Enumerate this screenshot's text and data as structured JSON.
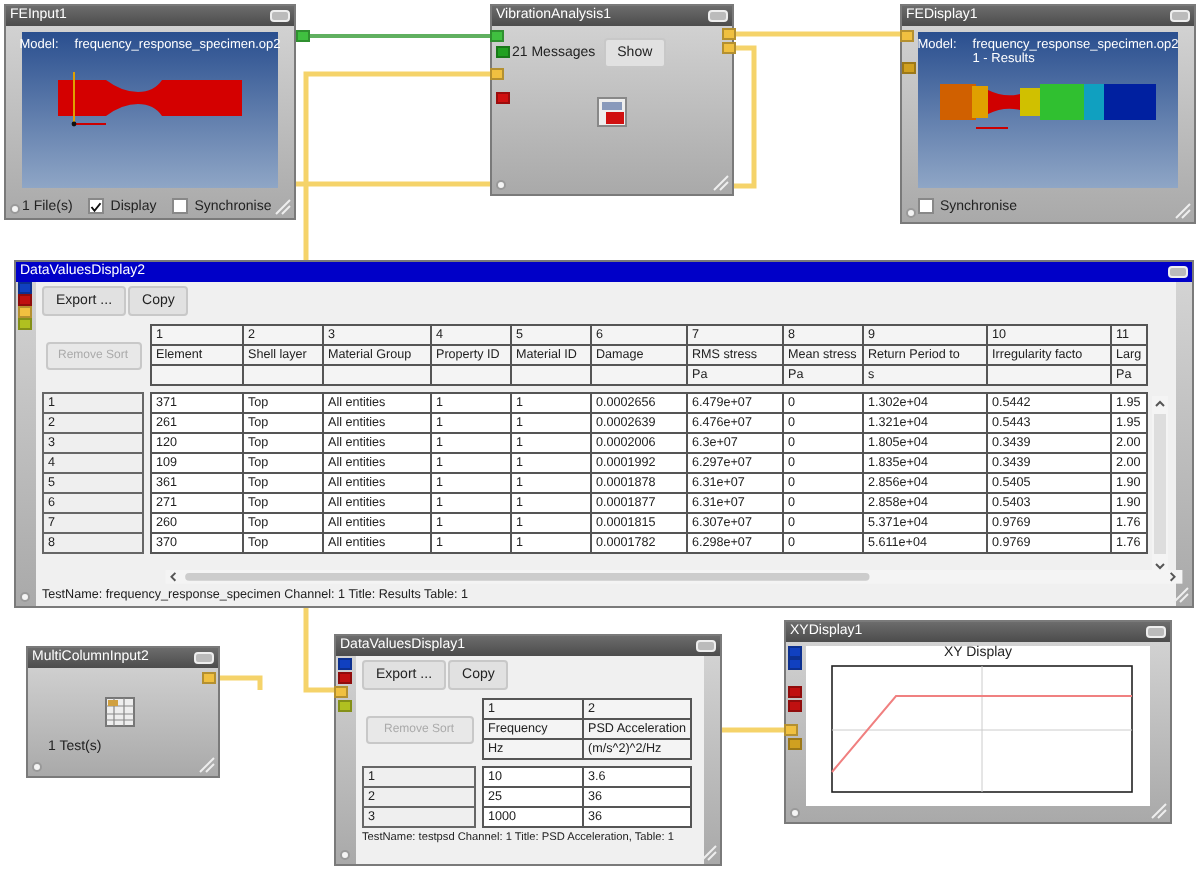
{
  "nodes": [
    {
      "kind": "fe_input",
      "title": "FEInput1",
      "selected": false,
      "model_label": "Model:",
      "model_file": "frequency_response_specimen.op2",
      "file_count": "1 File(s)",
      "display": {
        "label": "Display",
        "checked": true
      },
      "synchronise": {
        "label": "Synchronise",
        "checked": false
      }
    },
    {
      "kind": "vibration",
      "title": "VibrationAnalysis1",
      "selected": false,
      "messages": "21 Messages",
      "show_button": "Show"
    },
    {
      "kind": "fe_display",
      "title": "FEDisplay1",
      "selected": false,
      "model_label": "Model:",
      "model_file": "frequency_response_specimen.op2",
      "result": "1 - Results",
      "synchronise": {
        "label": "Synchronise",
        "checked": false
      }
    },
    {
      "kind": "table",
      "title": "DataValuesDisplay2",
      "selected": true,
      "buttons": [
        "Export ...",
        "Copy"
      ],
      "remove_sort": {
        "label": "Remove Sort",
        "disabled": true
      },
      "columns": [
        {
          "number": "1",
          "name": "Element"
        },
        {
          "number": "2",
          "name": "Shell layer"
        },
        {
          "number": "3",
          "name": "Material Group"
        },
        {
          "number": "4",
          "name": "Property ID"
        },
        {
          "number": "5",
          "name": "Material ID"
        },
        {
          "number": "6",
          "name": "Damage"
        },
        {
          "number": "7",
          "name": "RMS stress",
          "unit": "Pa"
        },
        {
          "number": "8",
          "name": "Mean stress",
          "unit": "Pa"
        },
        {
          "number": "9",
          "name": "Return Period to",
          "unit": "s"
        },
        {
          "number": "10",
          "name": "Irregularity facto"
        },
        {
          "number": "11",
          "name": "Larg",
          "unit": "Pa"
        }
      ],
      "rows": [
        {
          "header": "1",
          "cells": [
            "371",
            "Top",
            "All entities",
            "1",
            "1",
            "0.0002656",
            "6.479e+07",
            "0",
            "1.302e+04",
            "0.5442",
            "1.95"
          ]
        },
        {
          "header": "2",
          "cells": [
            "261",
            "Top",
            "All entities",
            "1",
            "1",
            "0.0002639",
            "6.476e+07",
            "0",
            "1.321e+04",
            "0.5443",
            "1.95"
          ]
        },
        {
          "header": "3",
          "cells": [
            "120",
            "Top",
            "All entities",
            "1",
            "1",
            "0.0002006",
            "6.3e+07",
            "0",
            "1.805e+04",
            "0.3439",
            "2.00"
          ]
        },
        {
          "header": "4",
          "cells": [
            "109",
            "Top",
            "All entities",
            "1",
            "1",
            "0.0001992",
            "6.297e+07",
            "0",
            "1.835e+04",
            "0.3439",
            "2.00"
          ]
        },
        {
          "header": "5",
          "cells": [
            "361",
            "Top",
            "All entities",
            "1",
            "1",
            "0.0001878",
            "6.31e+07",
            "0",
            "2.856e+04",
            "0.5405",
            "1.90"
          ]
        },
        {
          "header": "6",
          "cells": [
            "271",
            "Top",
            "All entities",
            "1",
            "1",
            "0.0001877",
            "6.31e+07",
            "0",
            "2.858e+04",
            "0.5403",
            "1.90"
          ]
        },
        {
          "header": "7",
          "cells": [
            "260",
            "Top",
            "All entities",
            "1",
            "1",
            "0.0001815",
            "6.307e+07",
            "0",
            "5.371e+04",
            "0.9769",
            "1.76"
          ]
        },
        {
          "header": "8",
          "cells": [
            "370",
            "Top",
            "All entities",
            "1",
            "1",
            "0.0001782",
            "6.298e+07",
            "0",
            "5.611e+04",
            "0.9769",
            "1.76"
          ]
        }
      ],
      "status": "TestName: frequency_response_specimen  Channel: 1  Title: Results  Table: 1"
    },
    {
      "kind": "multi_input",
      "title": "MultiColumnInput2",
      "selected": false,
      "tests": "1 Test(s)"
    },
    {
      "kind": "table",
      "title": "DataValuesDisplay1",
      "selected": false,
      "buttons": [
        "Export ...",
        "Copy"
      ],
      "remove_sort": {
        "label": "Remove Sort",
        "disabled": true
      },
      "columns": [
        {
          "number": "1",
          "name": "Frequency",
          "unit": "Hz"
        },
        {
          "number": "2",
          "name": "PSD Acceleration",
          "unit": "(m/s^2)^2/Hz"
        }
      ],
      "rows": [
        {
          "header": "1",
          "cells": [
            "10",
            "3.6"
          ]
        },
        {
          "header": "2",
          "cells": [
            "25",
            "36"
          ]
        },
        {
          "header": "3",
          "cells": [
            "1000",
            "36"
          ]
        }
      ],
      "status": "TestName: testpsd  Channel: 1  Title: PSD Acceleration,  Table: 1"
    },
    {
      "kind": "xy",
      "title": "XYDisplay1",
      "selected": false,
      "chart_title": "XY Display"
    }
  ]
}
